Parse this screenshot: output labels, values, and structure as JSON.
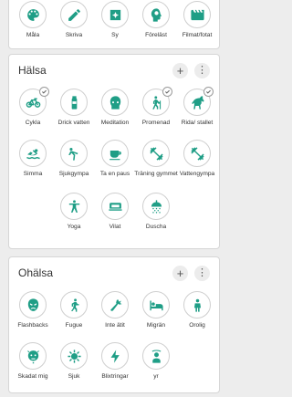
{
  "top": {
    "items": [
      {
        "label": "Måla",
        "icon": "palette-icon"
      },
      {
        "label": "Skriva",
        "icon": "pen-icon"
      },
      {
        "label": "Sy",
        "icon": "needle-icon"
      },
      {
        "label": "Föreläst",
        "icon": "head-speech-icon"
      },
      {
        "label": "Filmat/fotat",
        "icon": "film-camera-icon"
      }
    ]
  },
  "halsa": {
    "title": "Hälsa",
    "add": "+",
    "menu": "⋮",
    "items": [
      {
        "label": "Cykla",
        "icon": "bicycle-icon",
        "checked": true
      },
      {
        "label": "Drick vatten",
        "icon": "water-bottle-icon",
        "checked": false
      },
      {
        "label": "Meditation",
        "icon": "meditation-face-icon",
        "checked": false
      },
      {
        "label": "Promenad",
        "icon": "hiking-icon",
        "checked": true
      },
      {
        "label": "Rida/ stallet",
        "icon": "horse-icon",
        "checked": true
      },
      {
        "label": "Simma",
        "icon": "swimmer-icon",
        "checked": false
      },
      {
        "label": "Sjukgympa",
        "icon": "stretching-icon",
        "checked": false
      },
      {
        "label": "Ta en paus",
        "icon": "coffee-cup-icon",
        "checked": false
      },
      {
        "label": "Träning gymmet",
        "icon": "dumbbell-icon",
        "checked": false
      },
      {
        "label": "Vattengympa",
        "icon": "water-dumbbell-icon",
        "checked": false
      },
      {
        "label": "Yoga",
        "icon": "yoga-icon",
        "checked": false
      },
      {
        "label": "Vilat",
        "icon": "rest-icon",
        "checked": false
      },
      {
        "label": "Duscha",
        "icon": "shower-icon",
        "checked": false
      }
    ]
  },
  "ohalsa": {
    "title": "Ohälsa",
    "add": "+",
    "menu": "⋮",
    "items": [
      {
        "label": "Flashbacks",
        "icon": "angry-face-icon"
      },
      {
        "label": "Fugue",
        "icon": "walking-icon"
      },
      {
        "label": "Inte ätit",
        "icon": "carrot-icon"
      },
      {
        "label": "Migrän",
        "icon": "person-bed-icon"
      },
      {
        "label": "Orolig",
        "icon": "worried-icon"
      },
      {
        "label": "Skadat mig",
        "icon": "hurt-face-icon"
      },
      {
        "label": "Sjuk",
        "icon": "virus-icon"
      },
      {
        "label": "Blixtringar",
        "icon": "lightning-icon"
      },
      {
        "label": "yr",
        "icon": "dizzy-person-icon"
      }
    ]
  },
  "colors": {
    "accent": "#1f9e86",
    "background": "#ededed",
    "card": "#ffffff"
  }
}
